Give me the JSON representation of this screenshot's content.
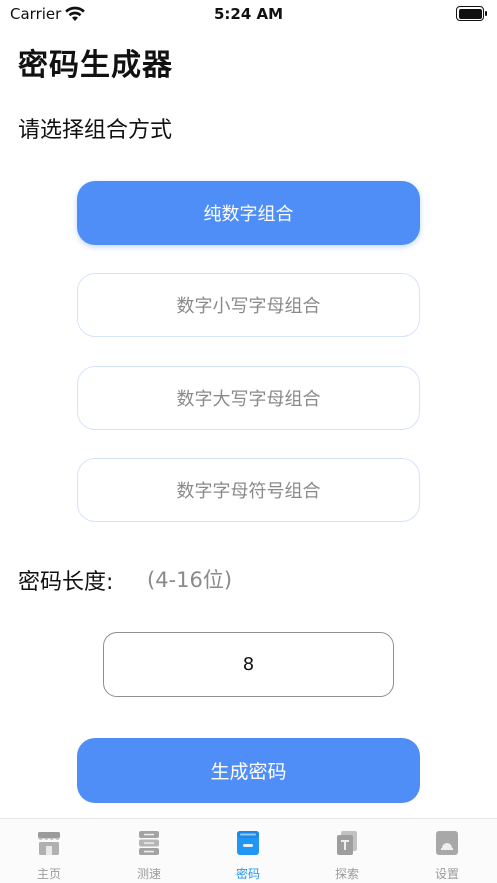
{
  "status_bar": {
    "carrier": "Carrier",
    "time": "5:24 AM",
    "icons": [
      "wifi-icon",
      "battery-icon"
    ]
  },
  "page": {
    "title": "密码生成器",
    "section_label": "请选择组合方式"
  },
  "options": [
    {
      "label": "纯数字组合",
      "selected": true
    },
    {
      "label": "数字小写字母组合",
      "selected": false
    },
    {
      "label": "数字大写字母组合",
      "selected": false
    },
    {
      "label": "数字字母符号组合",
      "selected": false
    }
  ],
  "length": {
    "label": "密码长度:",
    "hint": "(4-16位)",
    "value": "8"
  },
  "generate_button": {
    "label": "生成密码"
  },
  "tab_bar": {
    "tabs": [
      {
        "label": "主页",
        "icon": "storefront-icon",
        "active": false
      },
      {
        "label": "测速",
        "icon": "server-icon",
        "active": false
      },
      {
        "label": "密码",
        "icon": "safe-icon",
        "active": true
      },
      {
        "label": "探索",
        "icon": "explore-icon",
        "active": false
      },
      {
        "label": "设置",
        "icon": "settings-icon",
        "active": false
      }
    ]
  },
  "colors": {
    "accent": "#4f8ef6",
    "tab_active": "#2196f3",
    "tab_inactive": "#9b9b9b",
    "option_border": "#d6e4fb",
    "muted_text": "#8a8a8a"
  }
}
